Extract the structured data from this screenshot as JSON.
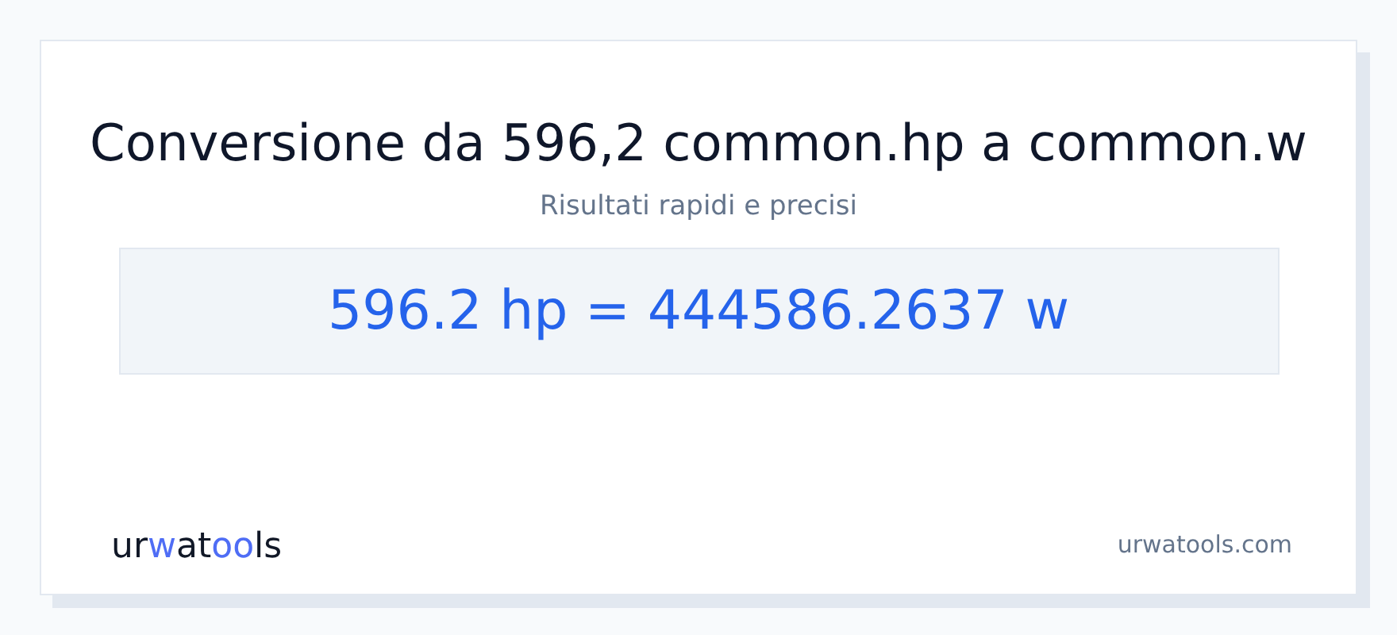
{
  "title": "Conversione da 596,2 common.hp a common.w",
  "subtitle": "Risultati rapidi e precisi",
  "result": "596.2 hp = 444586.2637 w",
  "footer": {
    "logo": [
      {
        "text": "ur",
        "accent": false
      },
      {
        "text": "w",
        "accent": true
      },
      {
        "text": "at",
        "accent": false
      },
      {
        "text": "oo",
        "accent": true
      },
      {
        "text": "ls",
        "accent": false
      }
    ],
    "site": "urwatools.com"
  }
}
